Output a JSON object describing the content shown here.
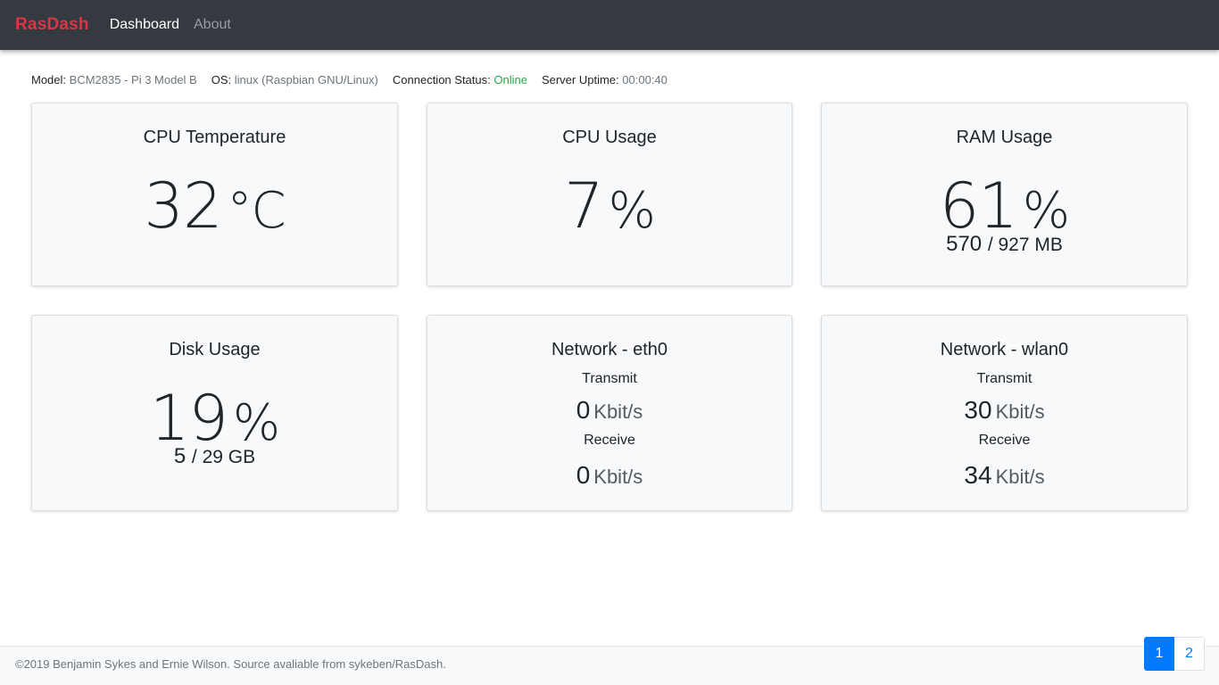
{
  "navbar": {
    "brand": "RasDash",
    "links": [
      "Dashboard",
      "About"
    ]
  },
  "info": {
    "model_label": "Model:",
    "model_value": "BCM2835 - Pi 3 Model B",
    "os_label": "OS:",
    "os_value": "linux (Raspbian GNU/Linux)",
    "connection_label": "Connection Status:",
    "connection_value": "Online",
    "uptime_label": "Server Uptime:",
    "uptime_value": "00:00:40"
  },
  "cards": {
    "cpu_temp": {
      "title": "CPU Temperature",
      "value": "32",
      "unit": "°C"
    },
    "cpu_usage": {
      "title": "CPU Usage",
      "value": "7",
      "unit": "%"
    },
    "ram_usage": {
      "title": "RAM Usage",
      "value": "61",
      "unit": "%",
      "used": "570",
      "total": "/ 927 MB"
    },
    "disk_usage": {
      "title": "Disk Usage",
      "value": "19",
      "unit": "%",
      "used": "5",
      "total": "/ 29 GB"
    },
    "eth0": {
      "title": "Network - eth0",
      "transmit_label": "Transmit",
      "transmit_value": "0",
      "transmit_unit": "Kbit/s",
      "receive_label": "Receive",
      "receive_value": "0",
      "receive_unit": "Kbit/s"
    },
    "wlan0": {
      "title": "Network - wlan0",
      "transmit_label": "Transmit",
      "transmit_value": "30",
      "transmit_unit": "Kbit/s",
      "receive_label": "Receive",
      "receive_value": "34",
      "receive_unit": "Kbit/s"
    }
  },
  "footer": {
    "text": "©2019 Benjamin Sykes and Ernie Wilson. Source avaliable from sykeben/RasDash."
  },
  "pagination": {
    "pages": [
      "1",
      "2"
    ],
    "active": "1"
  },
  "colors": {
    "brand": "#dc3545",
    "navbar": "#343a40",
    "online": "#28a745",
    "accent": "#007bff"
  }
}
